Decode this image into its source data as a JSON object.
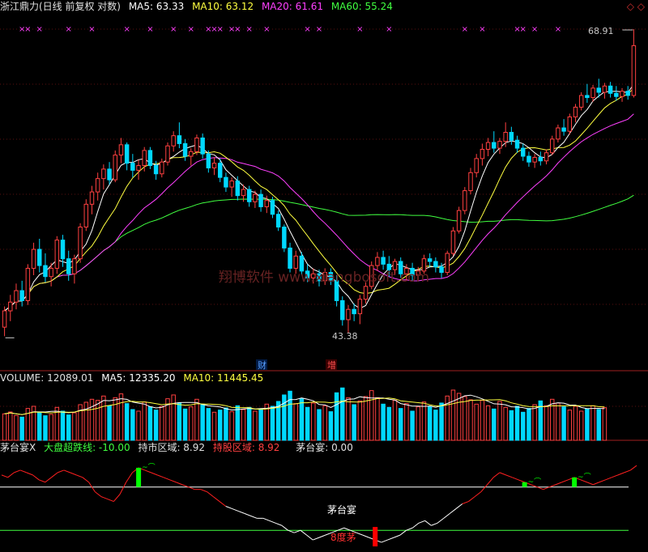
{
  "price_header": {
    "title": "浙江鼎力(日线 前复权 对数)",
    "ma5": "MA5: 63.33",
    "ma10": "MA10: 63.12",
    "ma20": "MA20: 61.61",
    "ma60": "MA60: 55.24"
  },
  "volume_header": {
    "volume": "VOLUME: 12089.01",
    "ma5": "MA5: 12335.20",
    "ma10": "MA10: 11445.45"
  },
  "indicator_header": {
    "name": "茅台宴X",
    "line1": "大盘超跌线: -10.00",
    "line2": "持市区域: 8.92",
    "line3": "持股区域: 8.92",
    "line4": "茅台宴: 0.00"
  },
  "corner_icons": "◇ ◇",
  "watermark": "翔博软件 www.xiangbosoft.com",
  "annotations": {
    "high_label": "68.91",
    "low_label": "43.38",
    "event_cai": "财",
    "event_zeng": "增",
    "signal_maotai": "茅台宴",
    "signal_8du": "8度茅"
  },
  "colors": {
    "up": "#ff4040",
    "down": "#00d8ff",
    "ma5": "#ffffff",
    "ma10": "#ffff40",
    "ma20": "#ff40ff",
    "ma60": "#40ff40",
    "volume_ma5": "#ffffff",
    "volume_ma10": "#ffff40",
    "indicator_line": "#ff2020",
    "indicator_low": "#ffffff",
    "signal_bar": "#00ff00",
    "signal_bar_low": "#ff0000",
    "marker": "#ff40ff"
  },
  "chart_data": {
    "type": "candlestick",
    "price_scale": "log",
    "price_range": [
      43.38,
      68.91
    ],
    "candles": [
      {
        "o": 43.8,
        "h": 45.2,
        "l": 43.2,
        "c": 44.9
      },
      {
        "o": 44.9,
        "h": 46.0,
        "l": 44.2,
        "c": 45.5
      },
      {
        "o": 45.5,
        "h": 46.8,
        "l": 45.0,
        "c": 46.3
      },
      {
        "o": 46.3,
        "h": 47.0,
        "l": 45.2,
        "c": 45.6
      },
      {
        "o": 45.6,
        "h": 48.2,
        "l": 45.3,
        "c": 47.9
      },
      {
        "o": 47.9,
        "h": 49.8,
        "l": 47.4,
        "c": 49.3
      },
      {
        "o": 49.3,
        "h": 50.1,
        "l": 47.6,
        "c": 48.1
      },
      {
        "o": 48.1,
        "h": 49.0,
        "l": 46.9,
        "c": 47.3
      },
      {
        "o": 47.3,
        "h": 48.3,
        "l": 46.6,
        "c": 47.9
      },
      {
        "o": 47.9,
        "h": 50.3,
        "l": 47.5,
        "c": 50.0
      },
      {
        "o": 50.0,
        "h": 50.4,
        "l": 48.0,
        "c": 48.6
      },
      {
        "o": 48.6,
        "h": 49.2,
        "l": 47.0,
        "c": 47.5
      },
      {
        "o": 47.5,
        "h": 48.9,
        "l": 46.8,
        "c": 48.6
      },
      {
        "o": 48.6,
        "h": 51.3,
        "l": 48.3,
        "c": 51.0
      },
      {
        "o": 51.0,
        "h": 53.2,
        "l": 50.7,
        "c": 52.8
      },
      {
        "o": 52.8,
        "h": 54.3,
        "l": 52.0,
        "c": 53.8
      },
      {
        "o": 53.8,
        "h": 55.4,
        "l": 53.1,
        "c": 54.9
      },
      {
        "o": 54.9,
        "h": 56.1,
        "l": 54.0,
        "c": 55.7
      },
      {
        "o": 55.7,
        "h": 56.3,
        "l": 54.4,
        "c": 54.8
      },
      {
        "o": 54.8,
        "h": 57.3,
        "l": 54.6,
        "c": 56.9
      },
      {
        "o": 56.9,
        "h": 58.4,
        "l": 56.2,
        "c": 57.8
      },
      {
        "o": 57.8,
        "h": 58.0,
        "l": 55.6,
        "c": 56.2
      },
      {
        "o": 56.2,
        "h": 57.0,
        "l": 55.0,
        "c": 55.6
      },
      {
        "o": 55.6,
        "h": 56.5,
        "l": 54.8,
        "c": 56.0
      },
      {
        "o": 56.0,
        "h": 57.6,
        "l": 55.5,
        "c": 57.3
      },
      {
        "o": 57.3,
        "h": 57.6,
        "l": 55.7,
        "c": 56.0
      },
      {
        "o": 56.0,
        "h": 56.4,
        "l": 54.8,
        "c": 55.3
      },
      {
        "o": 55.3,
        "h": 56.6,
        "l": 55.0,
        "c": 56.3
      },
      {
        "o": 56.3,
        "h": 58.0,
        "l": 56.0,
        "c": 57.7
      },
      {
        "o": 57.7,
        "h": 59.0,
        "l": 57.2,
        "c": 58.6
      },
      {
        "o": 58.6,
        "h": 59.8,
        "l": 57.5,
        "c": 57.9
      },
      {
        "o": 57.9,
        "h": 58.3,
        "l": 56.4,
        "c": 56.8
      },
      {
        "o": 56.8,
        "h": 57.5,
        "l": 56.0,
        "c": 57.2
      },
      {
        "o": 57.2,
        "h": 58.7,
        "l": 56.9,
        "c": 58.4
      },
      {
        "o": 58.4,
        "h": 58.8,
        "l": 56.6,
        "c": 57.0
      },
      {
        "o": 57.0,
        "h": 57.3,
        "l": 55.4,
        "c": 55.8
      },
      {
        "o": 55.8,
        "h": 56.7,
        "l": 55.2,
        "c": 56.2
      },
      {
        "o": 56.2,
        "h": 56.6,
        "l": 54.6,
        "c": 55.0
      },
      {
        "o": 55.0,
        "h": 55.4,
        "l": 53.8,
        "c": 54.2
      },
      {
        "o": 54.2,
        "h": 55.0,
        "l": 53.4,
        "c": 54.7
      },
      {
        "o": 54.7,
        "h": 55.1,
        "l": 53.1,
        "c": 53.5
      },
      {
        "o": 53.5,
        "h": 54.4,
        "l": 53.0,
        "c": 54.0
      },
      {
        "o": 54.0,
        "h": 54.3,
        "l": 52.6,
        "c": 53.0
      },
      {
        "o": 53.0,
        "h": 53.9,
        "l": 52.5,
        "c": 53.6
      },
      {
        "o": 53.6,
        "h": 54.0,
        "l": 52.2,
        "c": 52.6
      },
      {
        "o": 52.6,
        "h": 53.5,
        "l": 52.1,
        "c": 53.1
      },
      {
        "o": 53.1,
        "h": 53.4,
        "l": 51.7,
        "c": 52.0
      },
      {
        "o": 52.0,
        "h": 52.3,
        "l": 50.7,
        "c": 51.0
      },
      {
        "o": 51.0,
        "h": 51.2,
        "l": 49.1,
        "c": 49.4
      },
      {
        "o": 49.4,
        "h": 49.8,
        "l": 47.6,
        "c": 47.9
      },
      {
        "o": 47.9,
        "h": 49.2,
        "l": 47.5,
        "c": 48.8
      },
      {
        "o": 48.8,
        "h": 49.1,
        "l": 47.4,
        "c": 47.7
      },
      {
        "o": 47.7,
        "h": 48.2,
        "l": 46.9,
        "c": 47.2
      },
      {
        "o": 47.2,
        "h": 47.9,
        "l": 46.8,
        "c": 47.5
      },
      {
        "o": 47.5,
        "h": 47.8,
        "l": 46.6,
        "c": 47.0
      },
      {
        "o": 47.0,
        "h": 47.9,
        "l": 46.7,
        "c": 47.6
      },
      {
        "o": 47.6,
        "h": 47.9,
        "l": 46.7,
        "c": 47.0
      },
      {
        "o": 47.0,
        "h": 47.4,
        "l": 45.2,
        "c": 45.6
      },
      {
        "o": 45.6,
        "h": 45.9,
        "l": 43.9,
        "c": 44.3
      },
      {
        "o": 44.3,
        "h": 45.3,
        "l": 43.4,
        "c": 45.0
      },
      {
        "o": 45.0,
        "h": 45.4,
        "l": 44.2,
        "c": 44.7
      },
      {
        "o": 44.7,
        "h": 46.0,
        "l": 44.0,
        "c": 45.7
      },
      {
        "o": 45.7,
        "h": 46.9,
        "l": 45.4,
        "c": 46.6
      },
      {
        "o": 46.6,
        "h": 48.4,
        "l": 46.4,
        "c": 48.1
      },
      {
        "o": 48.1,
        "h": 49.1,
        "l": 47.7,
        "c": 48.7
      },
      {
        "o": 48.7,
        "h": 49.2,
        "l": 47.8,
        "c": 48.2
      },
      {
        "o": 48.2,
        "h": 48.8,
        "l": 47.3,
        "c": 47.8
      },
      {
        "o": 47.8,
        "h": 48.6,
        "l": 47.4,
        "c": 48.4
      },
      {
        "o": 48.4,
        "h": 48.7,
        "l": 47.2,
        "c": 47.5
      },
      {
        "o": 47.5,
        "h": 48.2,
        "l": 47.0,
        "c": 47.9
      },
      {
        "o": 47.9,
        "h": 48.3,
        "l": 47.0,
        "c": 47.4
      },
      {
        "o": 47.4,
        "h": 48.0,
        "l": 47.0,
        "c": 47.7
      },
      {
        "o": 47.7,
        "h": 48.9,
        "l": 47.5,
        "c": 48.6
      },
      {
        "o": 48.6,
        "h": 49.0,
        "l": 48.0,
        "c": 48.4
      },
      {
        "o": 48.4,
        "h": 48.7,
        "l": 47.6,
        "c": 48.0
      },
      {
        "o": 48.0,
        "h": 48.3,
        "l": 47.2,
        "c": 47.6
      },
      {
        "o": 47.6,
        "h": 49.2,
        "l": 47.4,
        "c": 49.0
      },
      {
        "o": 49.0,
        "h": 51.0,
        "l": 48.8,
        "c": 50.7
      },
      {
        "o": 50.7,
        "h": 52.6,
        "l": 50.5,
        "c": 52.3
      },
      {
        "o": 52.3,
        "h": 54.2,
        "l": 52.0,
        "c": 53.9
      },
      {
        "o": 53.9,
        "h": 55.8,
        "l": 53.6,
        "c": 55.4
      },
      {
        "o": 55.4,
        "h": 57.0,
        "l": 55.0,
        "c": 56.6
      },
      {
        "o": 56.6,
        "h": 57.9,
        "l": 56.0,
        "c": 57.4
      },
      {
        "o": 57.4,
        "h": 58.4,
        "l": 56.8,
        "c": 58.0
      },
      {
        "o": 58.0,
        "h": 59.0,
        "l": 57.1,
        "c": 57.5
      },
      {
        "o": 57.5,
        "h": 58.4,
        "l": 57.0,
        "c": 58.1
      },
      {
        "o": 58.1,
        "h": 59.8,
        "l": 57.6,
        "c": 58.9
      },
      {
        "o": 58.9,
        "h": 59.4,
        "l": 57.8,
        "c": 58.2
      },
      {
        "o": 58.2,
        "h": 58.6,
        "l": 57.1,
        "c": 57.5
      },
      {
        "o": 57.5,
        "h": 57.9,
        "l": 56.4,
        "c": 56.8
      },
      {
        "o": 56.8,
        "h": 57.2,
        "l": 55.9,
        "c": 56.3
      },
      {
        "o": 56.3,
        "h": 57.0,
        "l": 55.8,
        "c": 56.7
      },
      {
        "o": 56.7,
        "h": 57.2,
        "l": 56.0,
        "c": 56.4
      },
      {
        "o": 56.4,
        "h": 57.4,
        "l": 56.1,
        "c": 57.1
      },
      {
        "o": 57.1,
        "h": 58.6,
        "l": 56.9,
        "c": 58.3
      },
      {
        "o": 58.3,
        "h": 59.6,
        "l": 58.0,
        "c": 59.3
      },
      {
        "o": 59.3,
        "h": 60.1,
        "l": 58.6,
        "c": 59.0
      },
      {
        "o": 59.0,
        "h": 60.6,
        "l": 58.7,
        "c": 60.3
      },
      {
        "o": 60.3,
        "h": 61.5,
        "l": 59.8,
        "c": 61.2
      },
      {
        "o": 61.2,
        "h": 62.6,
        "l": 60.9,
        "c": 62.3
      },
      {
        "o": 62.3,
        "h": 63.4,
        "l": 61.6,
        "c": 62.1
      },
      {
        "o": 62.1,
        "h": 63.3,
        "l": 61.7,
        "c": 63.0
      },
      {
        "o": 63.0,
        "h": 63.9,
        "l": 62.1,
        "c": 62.6
      },
      {
        "o": 62.6,
        "h": 63.5,
        "l": 62.0,
        "c": 63.2
      },
      {
        "o": 63.2,
        "h": 63.6,
        "l": 62.1,
        "c": 62.5
      },
      {
        "o": 62.5,
        "h": 63.2,
        "l": 61.8,
        "c": 62.2
      },
      {
        "o": 62.2,
        "h": 63.0,
        "l": 61.7,
        "c": 62.7
      },
      {
        "o": 62.7,
        "h": 63.2,
        "l": 61.9,
        "c": 62.3
      },
      {
        "o": 62.3,
        "h": 68.91,
        "l": 62.1,
        "c": 67.2
      }
    ],
    "ma_series": [
      {
        "name": "MA5",
        "period": 5,
        "color": "#ffffff"
      },
      {
        "name": "MA10",
        "period": 10,
        "color": "#ffff40"
      },
      {
        "name": "MA20",
        "period": 20,
        "color": "#ff40ff"
      },
      {
        "name": "MA60",
        "period": 60,
        "color": "#40ff40"
      }
    ],
    "volume": [
      9800,
      10500,
      9200,
      8600,
      11800,
      12600,
      10400,
      9100,
      9600,
      12200,
      10800,
      9400,
      10200,
      13200,
      14100,
      15200,
      14800,
      16400,
      12800,
      15800,
      17200,
      13600,
      11400,
      10800,
      14200,
      12400,
      11200,
      12600,
      15400,
      16800,
      13800,
      11600,
      12400,
      15200,
      13200,
      11800,
      10400,
      11200,
      12000,
      10600,
      12800,
      11400,
      12200,
      10800,
      11600,
      13400,
      12600,
      14400,
      16800,
      18200,
      13600,
      15400,
      12200,
      13800,
      11400,
      12800,
      10600,
      17600,
      19400,
      15800,
      13200,
      14600,
      16200,
      18400,
      15800,
      13400,
      12200,
      14800,
      11800,
      13600,
      10800,
      12400,
      14200,
      12600,
      11200,
      13800,
      16400,
      18600,
      17400,
      16200,
      15000,
      13400,
      14800,
      12800,
      11600,
      14400,
      12200,
      11000,
      12600,
      10400,
      11800,
      13200,
      14600,
      12800,
      15200,
      13800,
      12400,
      11200,
      12600,
      10800,
      11600,
      12800,
      11400,
      12089.01
    ],
    "volume_ma_series": [
      {
        "name": "MA5",
        "period": 5,
        "color": "#ffffff"
      },
      {
        "name": "MA10",
        "period": 10,
        "color": "#ffff40"
      }
    ],
    "indicator": {
      "values": [
        5,
        4,
        6,
        7,
        6,
        5,
        3,
        2,
        4,
        6,
        7,
        6,
        5,
        4,
        2,
        -2,
        -4,
        -5,
        -6,
        -3,
        2,
        6,
        8,
        7,
        6,
        5,
        4,
        3,
        2,
        1,
        0,
        -1,
        -1,
        -2,
        -4,
        -6,
        -8,
        -9,
        -10,
        -11,
        -12,
        -13,
        -13,
        -14,
        -15,
        -16,
        -18,
        -19,
        -18,
        -20,
        -22,
        -21,
        -20,
        -19,
        -18,
        -17,
        -18,
        -19,
        -20,
        -21,
        -22,
        -23,
        -22,
        -21,
        -20,
        -18,
        -17,
        -15,
        -14,
        -16,
        -15,
        -13,
        -11,
        -9,
        -7,
        -6,
        -4,
        -2,
        1,
        4,
        6,
        5,
        4,
        3,
        2,
        1,
        0,
        -1,
        0,
        1,
        2,
        3,
        4,
        3,
        2,
        1,
        2,
        3,
        4,
        5,
        6,
        7,
        8.92
      ],
      "range": [
        -25,
        10
      ],
      "level_lines": [
        0,
        -18
      ],
      "signal_bars_up_index": [
        22,
        84,
        92
      ],
      "signal_bar_down_index": 60
    },
    "sell_markers_index": [
      3,
      4,
      6,
      11,
      15,
      21,
      25,
      29,
      32,
      35,
      36,
      37,
      39,
      40,
      42,
      45,
      52,
      54,
      61,
      66,
      79,
      82,
      88,
      89,
      91,
      95
    ]
  }
}
